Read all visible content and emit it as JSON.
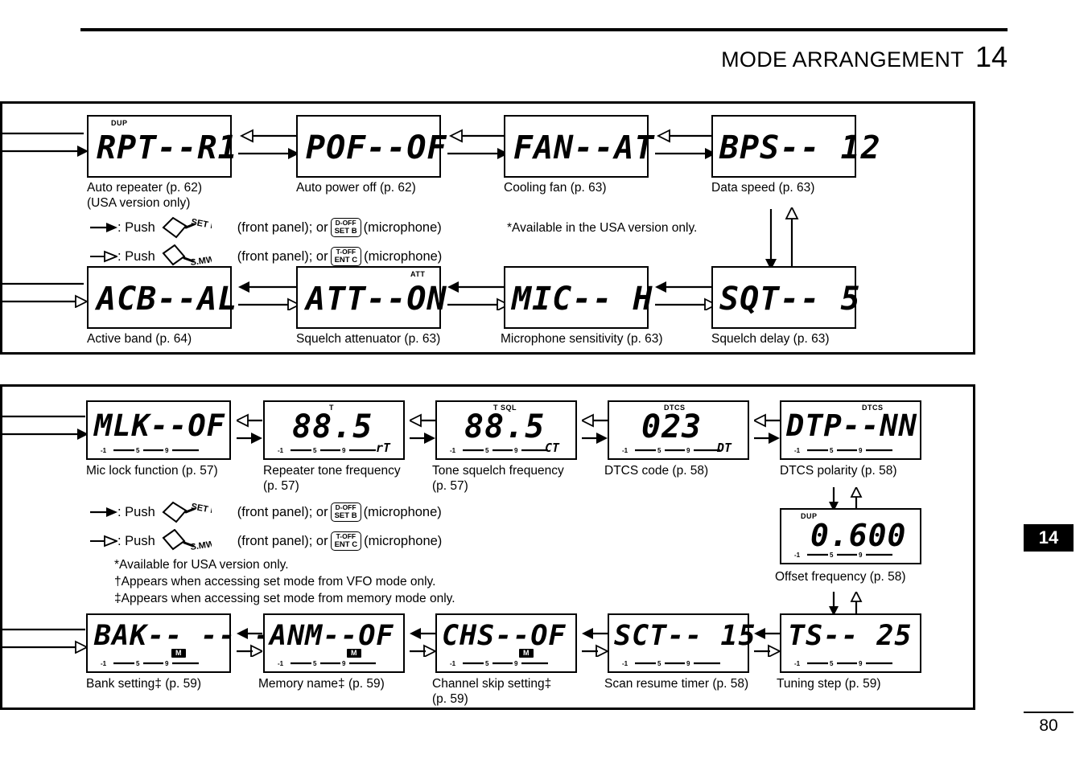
{
  "header": {
    "title": "MODE ARRANGEMENT",
    "chapter": "14"
  },
  "panel1": {
    "displays_row1": [
      {
        "lcd_text": "RPT--R1",
        "indicator": "DUP",
        "caption": "Auto repeater (p. 62)\n(USA version only)"
      },
      {
        "lcd_text": "POF--OF",
        "indicator": "",
        "caption": "Auto power off (p. 62)"
      },
      {
        "lcd_text": "FAN--AT",
        "indicator": "",
        "caption": "Cooling fan (p. 63)"
      },
      {
        "lcd_text": "BPS-- 12",
        "indicator": "",
        "caption": "Data speed (p. 63)"
      }
    ],
    "displays_row2": [
      {
        "lcd_text": "ACB--AL",
        "indicator": "",
        "caption": "Active band (p. 64)"
      },
      {
        "lcd_text": "ATT--ON",
        "indicator": "ATT",
        "caption": "Squelch attenuator (p. 63)"
      },
      {
        "lcd_text": "MIC-- H",
        "indicator": "",
        "caption": "Microphone sensitivity (p. 63)"
      },
      {
        "lcd_text": "SQT-- 5",
        "indicator": "",
        "caption": "Squelch delay (p. 63)"
      }
    ],
    "legend": {
      "row1": {
        "push_label": ": Push",
        "knob_label": "SET LOCK",
        "front_panel": "(front panel); or",
        "mic_btn_line1": "D-OFF",
        "mic_btn_line2": "SET B",
        "microphone": "(microphone)"
      },
      "row2": {
        "push_label": ": Push",
        "knob_label": "S.MW MW",
        "front_panel": "(front panel); or",
        "mic_btn_line1": "T-OFF",
        "mic_btn_line2": "ENT C",
        "microphone": "(microphone)"
      }
    },
    "usa_note": "*Available in the USA version only."
  },
  "panel2": {
    "displays_row1": [
      {
        "lcd_text": "MLK--OF",
        "indicator": "",
        "sub": "",
        "caption": "Mic lock function (p. 57)",
        "has_smeter": true
      },
      {
        "lcd_text": "88.5",
        "indicator": "T",
        "sub": "rT",
        "caption": "Repeater tone frequency\n(p. 57)",
        "has_smeter": true
      },
      {
        "lcd_text": "88.5",
        "indicator": "T SQL",
        "sub": "CT",
        "caption": "Tone squelch frequency\n(p. 57)",
        "has_smeter": true
      },
      {
        "lcd_text": "023",
        "indicator": "DTCS",
        "sub": "DT",
        "caption": "DTCS code (p. 58)",
        "has_smeter": true
      },
      {
        "lcd_text": "DTP--NN",
        "indicator": "DTCS",
        "sub": "",
        "caption": "DTCS polarity (p. 58)",
        "has_smeter": true
      }
    ],
    "displays_right": [
      {
        "lcd_text": "0.600",
        "indicator": "DUP",
        "caption": "Offset frequency (p. 58)",
        "has_smeter": true
      }
    ],
    "displays_row2": [
      {
        "lcd_text": "BAK-- -- --",
        "indicator": "",
        "badge": "M",
        "caption": "Bank setting‡ (p. 59)",
        "has_smeter": true
      },
      {
        "lcd_text": "ANM--OF",
        "indicator": "",
        "badge": "M",
        "caption": "Memory name‡ (p. 59)",
        "has_smeter": true
      },
      {
        "lcd_text": "CHS--OF",
        "indicator": "",
        "badge": "M",
        "caption": "Channel skip setting‡\n(p. 59)",
        "has_smeter": true
      },
      {
        "lcd_text": "SCT-- 15",
        "indicator": "",
        "badge": "",
        "caption": "Scan resume timer (p. 58)",
        "has_smeter": true
      },
      {
        "lcd_text": "TS-- 25",
        "indicator": "",
        "badge": "",
        "caption": "Tuning step (p. 59)",
        "has_smeter": true
      }
    ],
    "legend": {
      "row1": {
        "push_label": ": Push",
        "knob_label": "SET LOCK",
        "front_panel": "(front panel); or",
        "mic_btn_line1": "D-OFF",
        "mic_btn_line2": "SET B",
        "microphone": "(microphone)"
      },
      "row2": {
        "push_label": ": Push",
        "knob_label": "S.MW MW",
        "front_panel": "(front panel); or",
        "mic_btn_line1": "T-OFF",
        "mic_btn_line2": "ENT C",
        "microphone": "(microphone)"
      }
    },
    "notes": [
      "*Available for USA version only.",
      "†Appears when accessing set mode from VFO mode only.",
      "‡Appears when accessing set mode from memory mode only."
    ]
  },
  "smeter_labels": [
    "1",
    "5",
    "9"
  ],
  "footer": {
    "page_number": "80"
  }
}
